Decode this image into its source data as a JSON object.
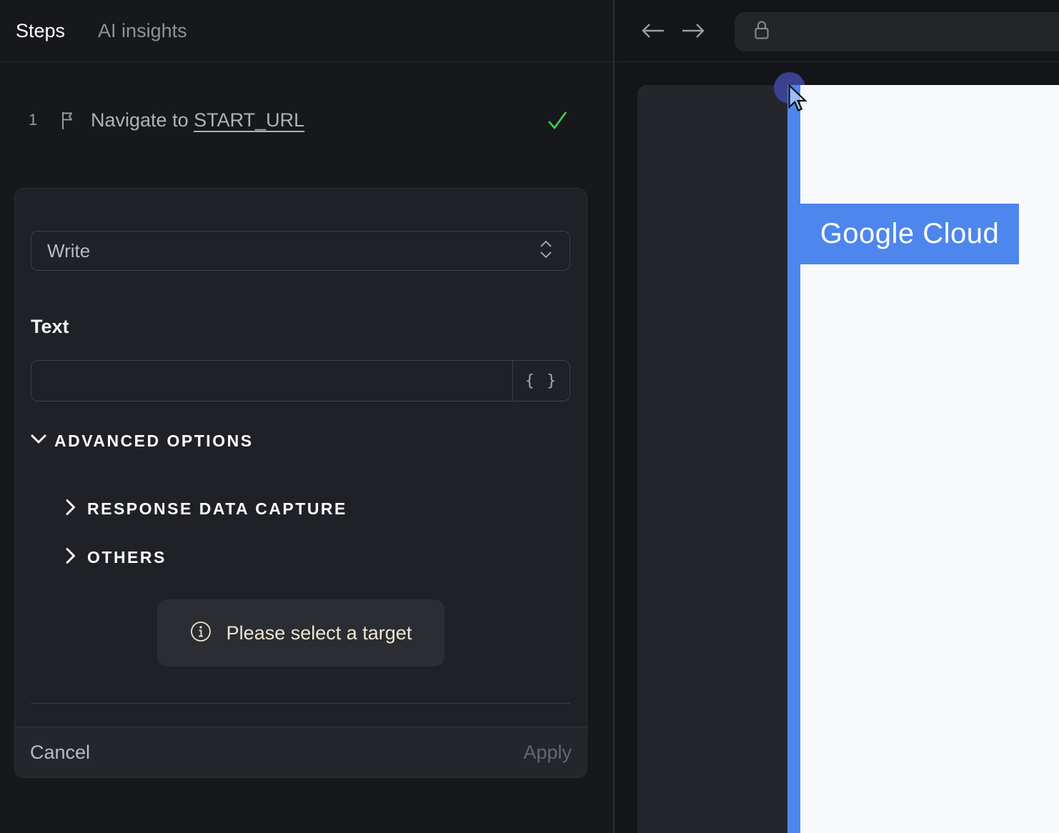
{
  "colors": {
    "accent_blue": "#4d86ed",
    "success_green": "#3ecf50",
    "notice_text": "#ece5d3",
    "highlight_indigo": "#3a4190",
    "panel_bg": "#17181c",
    "card_bg": "#1f2126",
    "site_content_bg": "#f8f9fa"
  },
  "left_panel": {
    "tabs": [
      {
        "label": "Steps"
      },
      {
        "label": "AI insights"
      }
    ],
    "step": {
      "index": "1",
      "icon": "flag",
      "text_prefix": "Navigate to ",
      "link_text": "START_URL",
      "status": "passed"
    },
    "editor": {
      "action_select": {
        "value": "Write"
      },
      "text_field": {
        "label": "Text",
        "value": "",
        "button_label": "{ }"
      },
      "advanced_options": {
        "label": "ADVANCED OPTIONS",
        "expanded": true,
        "sections": [
          {
            "label": "RESPONSE DATA CAPTURE"
          },
          {
            "label": "OTHERS"
          }
        ]
      },
      "notice": {
        "icon": "info",
        "text": "Please select a target"
      },
      "footer": {
        "cancel_label": "Cancel",
        "apply_label": "Apply"
      }
    }
  },
  "browser": {
    "nav": {
      "back": "back",
      "forward": "forward"
    },
    "url_bar": {
      "icon": "lock",
      "value": ""
    },
    "page": {
      "highlight_label": "Google Cloud"
    }
  }
}
